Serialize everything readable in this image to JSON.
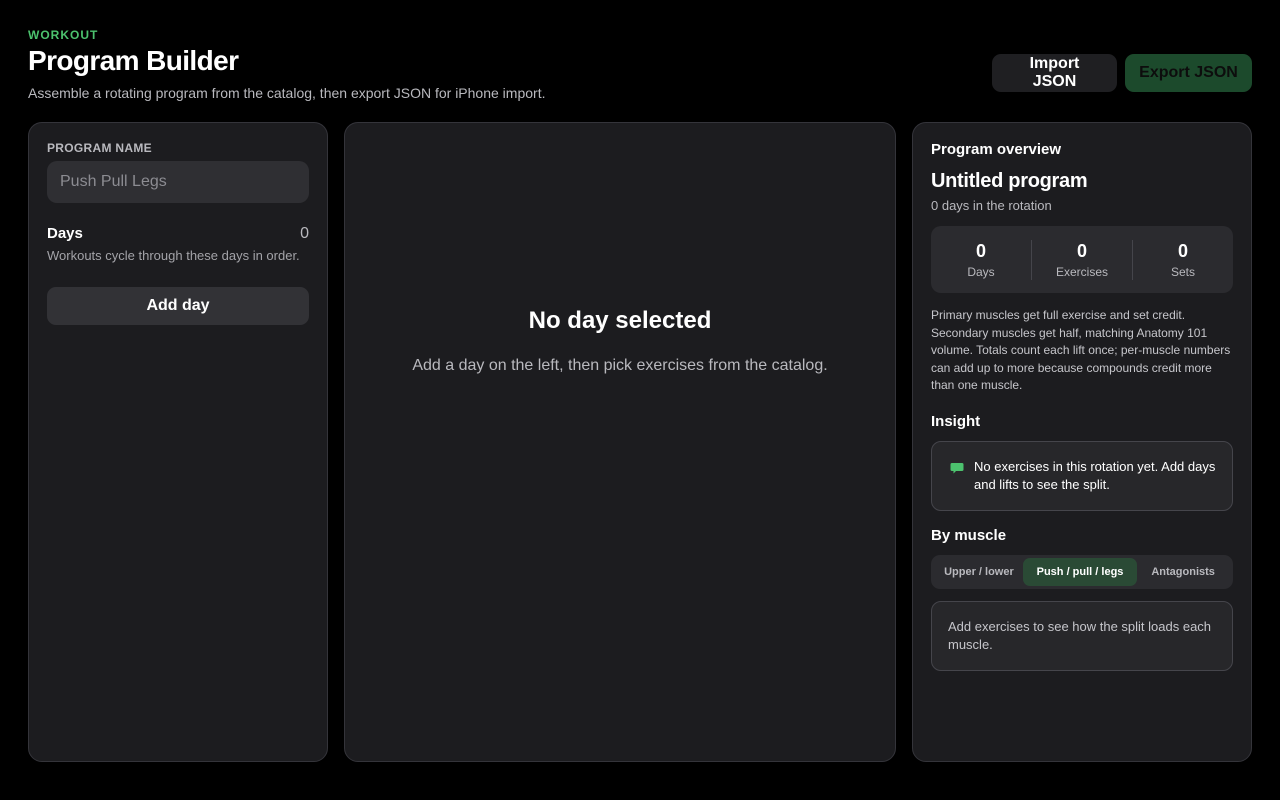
{
  "header": {
    "eyebrow": "WORKOUT",
    "title": "Program Builder",
    "subtitle": "Assemble a rotating program from the catalog, then export JSON for iPhone import.",
    "import_label": "Import JSON",
    "export_label": "Export JSON"
  },
  "left_panel": {
    "program_name_label": "PROGRAM NAME",
    "program_name_value": "",
    "program_name_placeholder": "Push Pull Legs",
    "days_title": "Days",
    "days_count": "0",
    "days_desc": "Workouts cycle through these days in order.",
    "add_day_label": "Add day"
  },
  "center_panel": {
    "empty_title": "No day selected",
    "empty_desc": "Add a day on the left, then pick exercises from the catalog."
  },
  "overview": {
    "section_title": "Program overview",
    "program_name": "Untitled program",
    "rotation_text": "0 days in the rotation",
    "stats": [
      {
        "value": "0",
        "label": "Days"
      },
      {
        "value": "0",
        "label": "Exercises"
      },
      {
        "value": "0",
        "label": "Sets"
      }
    ],
    "explain": "Primary muscles get full exercise and set credit. Secondary muscles get half, matching Anatomy 101 volume. Totals count each lift once; per-muscle numbers can add up to more because compounds credit more than one muscle.",
    "insight_title": "Insight",
    "insight_icon": "chat-bubble-icon",
    "insight_text": "No exercises in this rotation yet. Add days and lifts to see the split.",
    "by_muscle_title": "By muscle",
    "split_options": [
      "Upper / lower",
      "Push / pull / legs",
      "Antagonists"
    ],
    "split_selected": "Push / pull / legs",
    "muscle_empty": "Add exercises to see how the split loads each muscle."
  },
  "colors": {
    "accent": "#4cc26e",
    "export_bg": "#1c4a2c",
    "selected_segment_bg": "#2a4a35",
    "panel_bg": "#1c1c1f",
    "page_bg": "#000000"
  }
}
